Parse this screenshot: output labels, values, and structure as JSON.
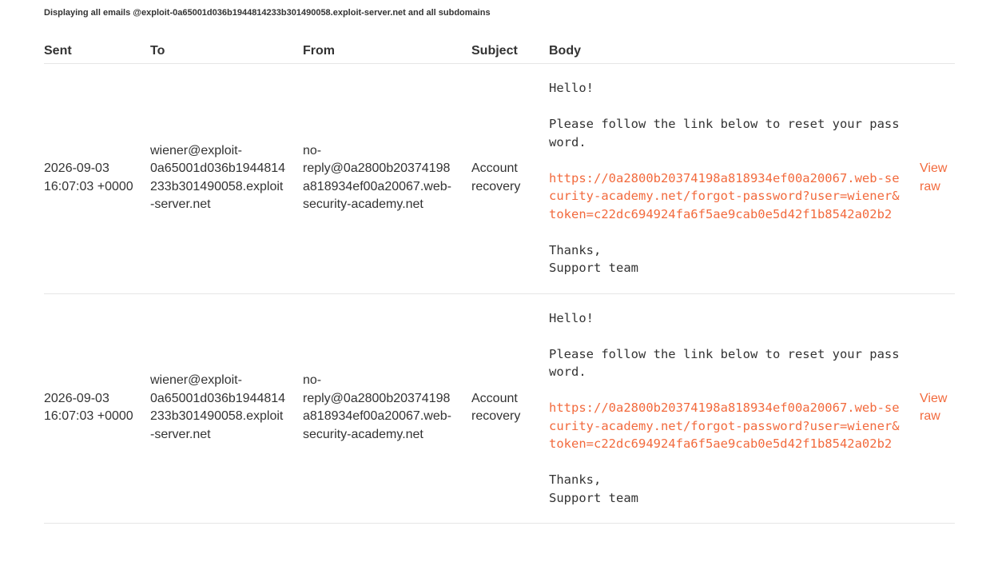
{
  "banner": "Displaying all emails @exploit-0a65001d036b1944814233b301490058.exploit-server.net and all subdomains",
  "table": {
    "headers": [
      "Sent",
      "To",
      "From",
      "Subject",
      "Body"
    ],
    "rows": [
      {
        "sent": "2026-09-03 16:07:03 +0000",
        "to": "wiener@exploit-0a65001d036b1944814233b301490058.exploit-server.net",
        "from": "no-reply@0a2800b20374198a818934ef00a20067.web-security-academy.net",
        "subject": "Account recovery",
        "body": {
          "greeting": "Hello!",
          "instruction": "Please follow the link below to reset your password.",
          "link": "https://0a2800b20374198a818934ef00a20067.web-security-academy.net/forgot-password?user=wiener&token=c22dc694924fa6f5ae9cab0e5d42f1b8542a02b2",
          "signoff": "Thanks,",
          "signature": "Support team"
        },
        "view_raw": "View raw"
      },
      {
        "sent": "2026-09-03 16:07:03 +0000",
        "to": "wiener@exploit-0a65001d036b1944814233b301490058.exploit-server.net",
        "from": "no-reply@0a2800b20374198a818934ef00a20067.web-security-academy.net",
        "subject": "Account recovery",
        "body": {
          "greeting": "Hello!",
          "instruction": "Please follow the link below to reset your password.",
          "link": "https://0a2800b20374198a818934ef00a20067.web-security-academy.net/forgot-password?user=wiener&token=c22dc694924fa6f5ae9cab0e5d42f1b8542a02b2",
          "signoff": "Thanks,",
          "signature": "Support team"
        },
        "view_raw": "View raw"
      }
    ]
  },
  "colors": {
    "text": "#333333",
    "link": "#f26a3d",
    "divider": "#e6e6e6"
  }
}
